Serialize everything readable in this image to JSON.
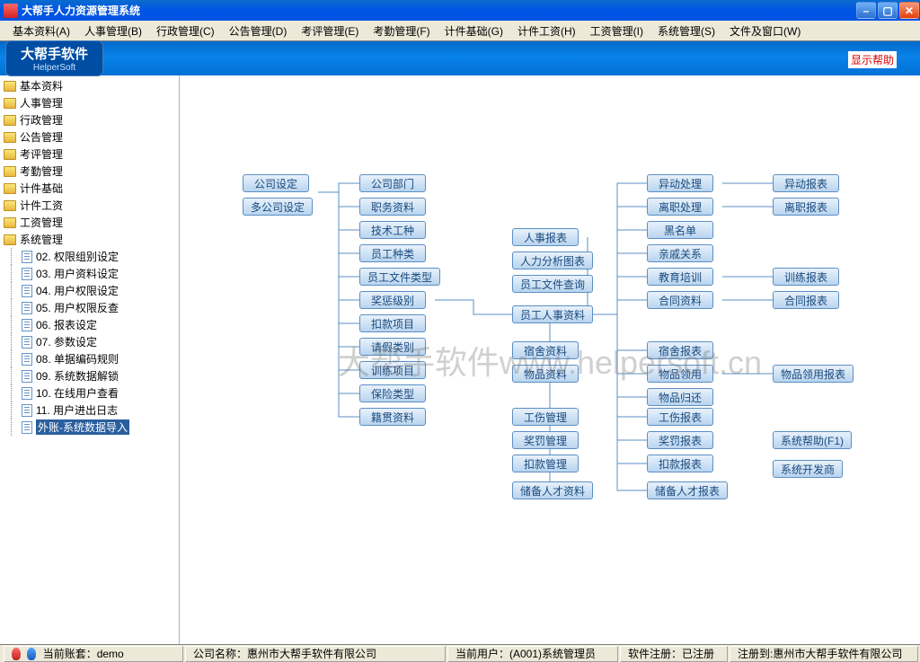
{
  "title": "大帮手人力资源管理系统",
  "menu": [
    "基本资料(A)",
    "人事管理(B)",
    "行政管理(C)",
    "公告管理(D)",
    "考评管理(E)",
    "考勤管理(F)",
    "计件基础(G)",
    "计件工资(H)",
    "工资管理(I)",
    "系统管理(S)",
    "文件及窗口(W)"
  ],
  "logo": {
    "zh": "大帮手软件",
    "en": "HelperSoft"
  },
  "help_link": "显示帮助",
  "watermark": "大帮手软件www.helpersoft.cn",
  "sidebar": {
    "folders": [
      "基本资料",
      "人事管理",
      "行政管理",
      "公告管理",
      "考评管理",
      "考勤管理",
      "计件基础",
      "计件工资",
      "工资管理",
      "系统管理"
    ],
    "subs": [
      "02. 权限组别设定",
      "03. 用户资料设定",
      "04. 用户权限设定",
      "05. 用户权限反查",
      "06. 报表设定",
      "07. 参数设定",
      "08. 单据编码规则",
      "09. 系统数据解锁",
      "10. 在线用户查看",
      "11. 用户进出日志",
      "外账-系统数据导入"
    ],
    "selected_index": 10
  },
  "nodes": {
    "c1a": "公司设定",
    "c1b": "多公司设定",
    "c2": [
      "公司部门",
      "职务资料",
      "技术工种",
      "员工种类",
      "员工文件类型",
      "奖惩级别",
      "扣款项目",
      "请假类别",
      "训练项目",
      "保险类型",
      "籍贯资料"
    ],
    "c3": [
      "人事报表",
      "人力分析图表",
      "员工文件查询",
      "员工人事资料",
      "宿舍资料",
      "物品资料",
      "工伤管理",
      "奖罚管理",
      "扣款管理",
      "储备人才资料"
    ],
    "c4": [
      "异动处理",
      "离职处理",
      "黑名单",
      "亲戚关系",
      "教育培训",
      "合同资料",
      "宿舍报表",
      "物品领用",
      "物品归还",
      "工伤报表",
      "奖罚报表",
      "扣款报表",
      "储备人才报表"
    ],
    "c5": [
      "异动报表",
      "离职报表",
      "训练报表",
      "合同报表",
      "物品领用报表",
      "系统帮助(F1)",
      "系统开发商"
    ]
  },
  "status": {
    "account": "当前账套：demo",
    "company": "公司名称：惠州市大帮手软件有限公司",
    "user": "当前用户：(A001)系统管理员",
    "reg": "软件注册：已注册",
    "regto": "注册到:惠州市大帮手软件有限公司"
  }
}
